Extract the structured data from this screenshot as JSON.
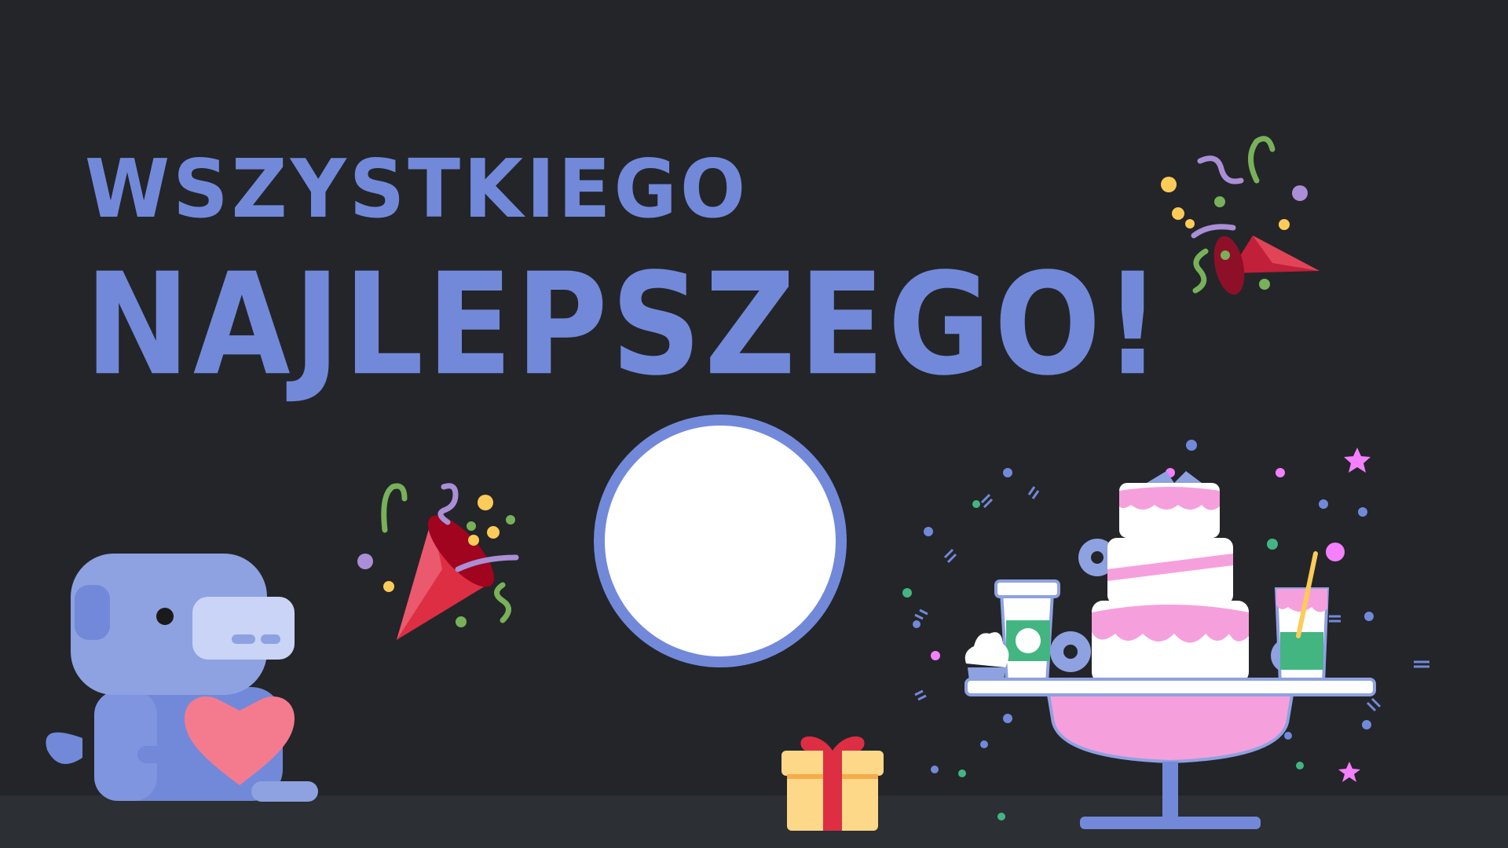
{
  "greeting": {
    "line1": "WSZYSTKIEGO",
    "line2": "NAJLEPSZEGO!"
  },
  "colors": {
    "background": "#232529",
    "floor": "#2c2f33",
    "accent": "#7289da",
    "avatar_fill": "#ffffff"
  },
  "icons": {
    "party_popper_top_right": "party-popper-icon",
    "party_popper_left": "party-popper-icon",
    "mascot": "wumpus-holding-heart",
    "avatar": "avatar-placeholder",
    "gift": "gift-icon",
    "cake_table": "birthday-cake-table"
  }
}
